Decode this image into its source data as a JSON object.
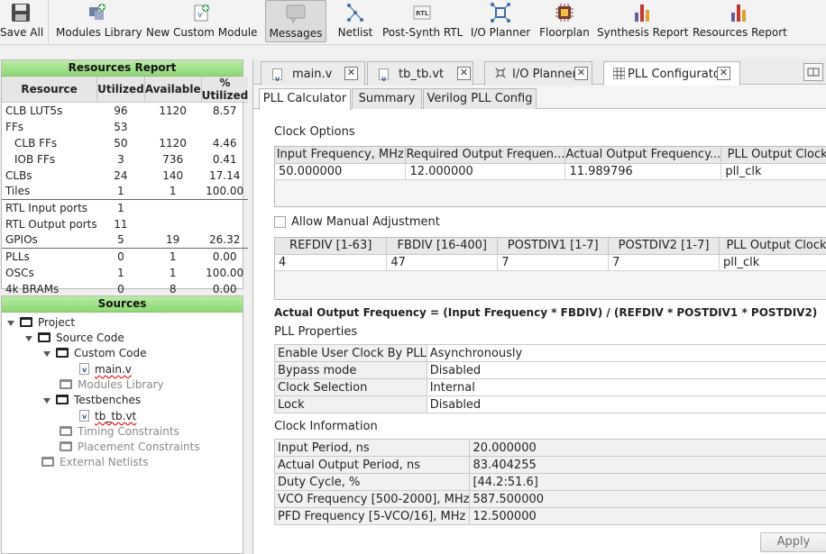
{
  "toolbar": [
    {
      "label": "Save All",
      "icon": "floppy-disk-icon"
    },
    {
      "label": "Modules Library",
      "icon": "modules-library-icon"
    },
    {
      "label": "New Custom Module",
      "icon": "new-module-icon"
    },
    {
      "label": "Messages",
      "icon": "speech-bubble-icon",
      "active": true
    },
    {
      "label": "Netlist",
      "icon": "netlist-icon"
    },
    {
      "label": "Post-Synth RTL",
      "icon": "rtl-icon"
    },
    {
      "label": "I/O Planner",
      "icon": "io-planner-icon"
    },
    {
      "label": "Floorplan",
      "icon": "chip-icon"
    },
    {
      "label": "Synthesis Report",
      "icon": "bar-chart-icon"
    },
    {
      "label": "Resources Report",
      "icon": "bar-chart-icon"
    }
  ],
  "resources_report": {
    "title": "Resources Report",
    "headers": [
      "Resource",
      "Utilized",
      "Available",
      "% Utilized"
    ],
    "rows": [
      [
        "CLB LUT5s",
        "96",
        "1120",
        "8.57"
      ],
      [
        "FFs",
        "53",
        "",
        ""
      ],
      [
        "CLB FFs",
        "50",
        "1120",
        "4.46"
      ],
      [
        "IOB FFs",
        "3",
        "736",
        "0.41"
      ],
      [
        "CLBs",
        "24",
        "140",
        "17.14"
      ],
      [
        "Tiles",
        "1",
        "1",
        "100.00"
      ],
      [
        "RTL Input ports",
        "1",
        "",
        ""
      ],
      [
        "RTL Output ports",
        "11",
        "",
        ""
      ],
      [
        "GPIOs",
        "5",
        "19",
        "26.32"
      ],
      [
        "PLLs",
        "0",
        "1",
        "0.00"
      ],
      [
        "OSCs",
        "1",
        "1",
        "100.00"
      ],
      [
        "4k BRAMs",
        "0",
        "8",
        "0.00"
      ]
    ]
  },
  "sources": {
    "title": "Sources",
    "tree": [
      {
        "label": "Project",
        "type": "folder"
      },
      {
        "label": "Source Code",
        "type": "folder"
      },
      {
        "label": "Custom Code",
        "type": "folder"
      },
      {
        "label": "main.v",
        "type": "file"
      },
      {
        "label": "Modules Library",
        "type": "greyfolder"
      },
      {
        "label": "Testbenches",
        "type": "folder"
      },
      {
        "label": "tb_tb.vt",
        "type": "file"
      },
      {
        "label": "Timing Constraints",
        "type": "greyfolder"
      },
      {
        "label": "Placement Constraints",
        "type": "greyfolder"
      },
      {
        "label": "External Netlists",
        "type": "greyfolder"
      }
    ]
  },
  "file_tabs": [
    "main.v",
    "tb_tb.vt",
    "I/O Planner",
    "PLL Configurator"
  ],
  "sub_tabs": [
    "PLL Calculator",
    "Summary",
    "Verilog PLL Config"
  ],
  "clock_options": {
    "title": "Clock Options",
    "headers": [
      "Input Frequency, MHz",
      "Required Output Frequen...",
      "Actual Output Frequency...",
      "PLL Output Clock"
    ],
    "row": [
      "50.000000",
      "12.000000",
      "11.989796",
      "pll_clk"
    ]
  },
  "manual_adjustment_label": "Allow Manual Adjustment",
  "dividers": {
    "headers": [
      "REFDIV [1-63]",
      "FBDIV [16-400]",
      "POSTDIV1 [1-7]",
      "POSTDIV2 [1-7]",
      "PLL Output Clock"
    ],
    "row": [
      "4",
      "47",
      "7",
      "7",
      "pll_clk"
    ]
  },
  "formula": "Actual Output Frequency = (Input Frequency * FBDIV) / (REFDIV * POSTDIV1 * POSTDIV2)",
  "pll_properties": {
    "title": "PLL Properties",
    "rows": [
      [
        "Enable User Clock By PLL",
        "Asynchronously"
      ],
      [
        "Bypass mode",
        "Disabled"
      ],
      [
        "Clock Selection",
        "Internal"
      ],
      [
        "Lock",
        "Disabled"
      ]
    ]
  },
  "clock_information": {
    "title": "Clock Information",
    "rows": [
      [
        "Input Period, ns",
        "20.000000"
      ],
      [
        "Actual Output Period, ns",
        "83.404255"
      ],
      [
        "Duty Cycle, %",
        "[44.2:51.6]"
      ],
      [
        "VCO Frequency [500-2000], MHz",
        "587.500000"
      ],
      [
        "PFD Frequency [5-VCO/16], MHz",
        "12.500000"
      ]
    ]
  },
  "apply_label": "Apply"
}
